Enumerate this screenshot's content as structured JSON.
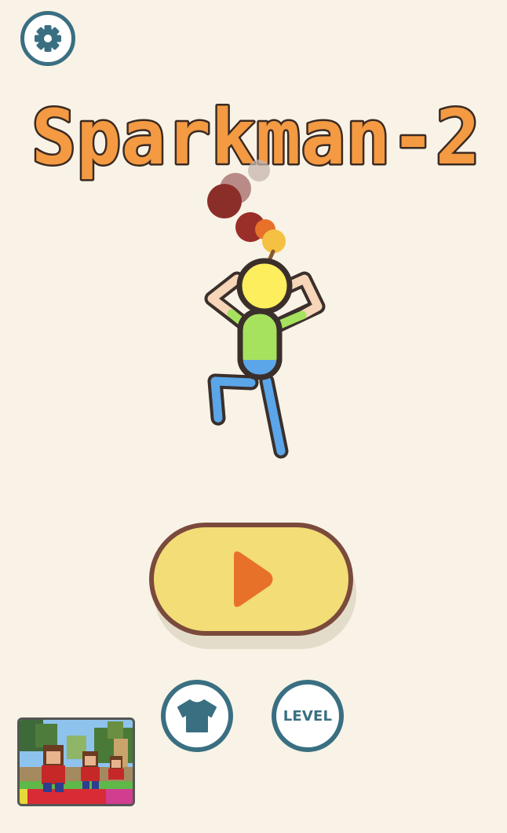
{
  "colors": {
    "background": "#f8f3e6",
    "teal": "#3a6f82",
    "brown": "#7a4a3c",
    "button_yellow": "#f2dd77",
    "play_orange": "#e8712a",
    "title_orange": "#f39a43"
  },
  "header": {
    "settings_icon": "gear-icon"
  },
  "title": {
    "text": "Sparkman-2"
  },
  "play": {
    "icon": "play-icon"
  },
  "buttons": {
    "skin_icon": "shirt-icon",
    "level_label": "LEVEL"
  },
  "ad": {
    "icon": "game-thumbnail"
  }
}
